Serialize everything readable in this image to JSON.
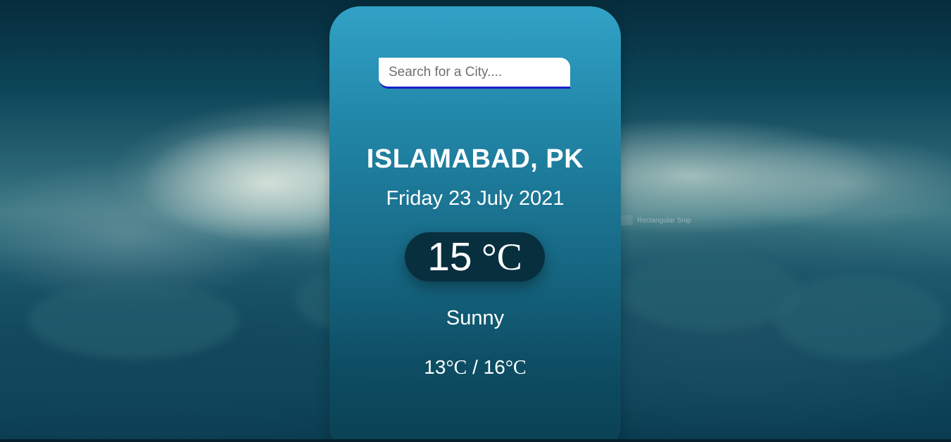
{
  "search": {
    "placeholder": "Search for a City...."
  },
  "weather": {
    "location": "ISLAMABAD, PK",
    "date": "Friday 23 July 2021",
    "temperature": "15",
    "unit": "°C",
    "condition": "Sunny",
    "low": "13",
    "high": "16",
    "range_separator": " / "
  },
  "overlay": {
    "snip_label": "Rectangular Snip"
  },
  "colors": {
    "card_top": "#31a2c6",
    "card_bottom": "#0a3f52",
    "search_underline": "#1b1fc9",
    "temp_pill": "#082f3e"
  }
}
